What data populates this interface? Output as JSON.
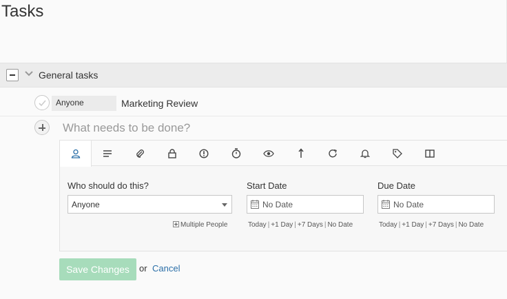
{
  "page": {
    "title": "Tasks"
  },
  "group": {
    "title": "General tasks"
  },
  "task": {
    "assignee": "Anyone",
    "name": "Marketing Review"
  },
  "new_task": {
    "placeholder": "What needs to be done?"
  },
  "toolbar": {
    "icons": [
      "person-icon",
      "description-icon",
      "attachment-icon",
      "lock-icon",
      "priority-icon",
      "timer-icon",
      "eye-icon",
      "arrow-up-icon",
      "repeat-icon",
      "bell-icon",
      "tag-icon",
      "columns-icon"
    ]
  },
  "form": {
    "assignee_label": "Who should do this?",
    "assignee_value": "Anyone",
    "multiple_people": "Multiple People",
    "start_label": "Start Date",
    "start_placeholder": "No Date",
    "due_label": "Due Date",
    "due_placeholder": "No Date",
    "quick": {
      "today": "Today",
      "plus1": "+1 Day",
      "plus7": "+7 Days",
      "nodate": "No Date"
    }
  },
  "actions": {
    "save": "Save Changes",
    "or": "or",
    "cancel": "Cancel"
  },
  "colors": {
    "accent": "#2b6fa8",
    "save_bg": "#a7dcbb",
    "group_bg": "#ececec"
  }
}
